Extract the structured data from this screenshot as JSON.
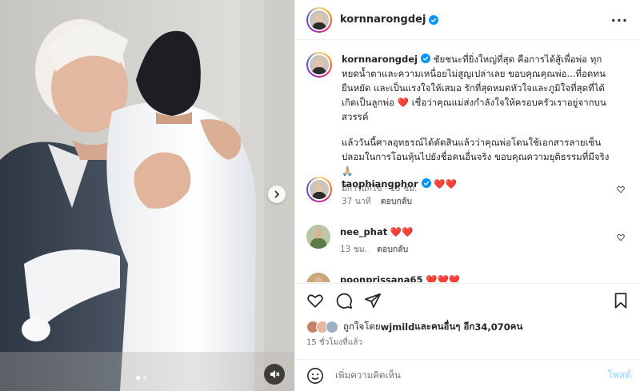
{
  "post": {
    "username": "kornnarongdej",
    "more_icon": "more-horizontal-icon"
  },
  "caption": {
    "username": "kornnarongdej",
    "text_1": " ชัยชนะที่ยิ่งใหญ่ที่สุด คือการได้สู้เพื่อพ่อ ทุกหยดน้ำตาและความเหนื่อยไม่สูญเปล่าเลย ขอบคุณคุณพ่อ...ที่อดทน ยืนหยัด และเป็นแรงใจให้เสมอ รักที่สุดหมดหัวใจและภูมิใจที่สุดที่ได้เกิดเป็นลูกพ่อ ",
    "heart": "❤️",
    "text_2": " เชื่อว่าคุณแม่ส่งกำลังใจให้ครอบครัวเราอยู่จากบนสวรรค์",
    "text_3": "แล้ววันนี้ศาลอุทธรณ์ได้ตัดสินแล้วว่าคุณพ่อโดนใช้เอกสารลายเซ็นปลอมในการโอนหุ้นไปยังชื่อคนอื่นจริง ขอบคุณความยุติธรรมที่มีจริง 🙏🏼",
    "edited": "มีการแก้ไข · 15 ชม."
  },
  "comments": [
    {
      "username": "taophiangphor",
      "text": "❤️❤️",
      "time": "37 นาที",
      "reply": "ตอบกลับ",
      "verified": true
    },
    {
      "username": "nee_phat",
      "text": "❤️❤️",
      "time": "13 ชม.",
      "reply": "ตอบกลับ",
      "verified": false
    },
    {
      "username": "poonprissana65",
      "text": "❤️❤️❤️",
      "time": "",
      "reply": "",
      "verified": false
    }
  ],
  "likes": {
    "prefix": "ถูกใจโดย ",
    "user": "wjmild",
    "middle": " และคนอื่นๆ อีก ",
    "count": "34,070",
    "suffix": " คน"
  },
  "timestamp": "15 ชั่วโมงที่แล้ว",
  "comment_input": {
    "placeholder": "เพิ่มความคิดเห็น",
    "post_label": "โพสต์"
  },
  "colors": {
    "verified_blue": "#0095f6",
    "heart_red": "#ed2245",
    "muted_text": "#737373"
  }
}
